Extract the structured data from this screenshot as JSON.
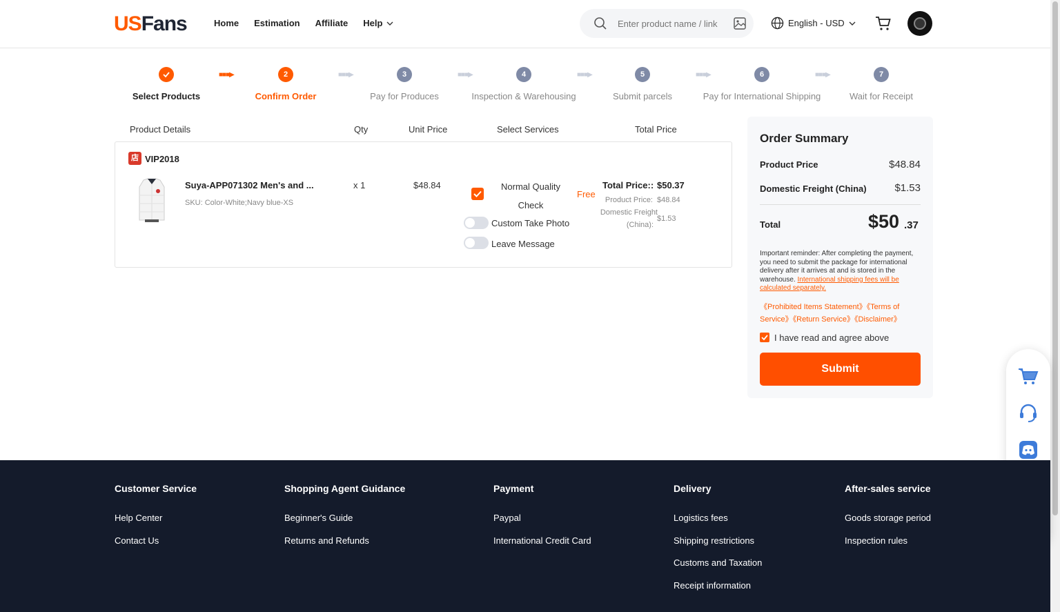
{
  "header": {
    "logo_us": "US",
    "logo_fans": "Fans",
    "nav": [
      "Home",
      "Estimation",
      "Affiliate",
      "Help"
    ],
    "search_placeholder": "Enter product name / link",
    "language": "English - USD"
  },
  "steps": [
    {
      "num": "",
      "label": "Select Products",
      "state": "done"
    },
    {
      "num": "2",
      "label": "Confirm Order",
      "state": "active"
    },
    {
      "num": "3",
      "label": "Pay for Produces",
      "state": "todo"
    },
    {
      "num": "4",
      "label": "Inspection & Warehousing",
      "state": "todo"
    },
    {
      "num": "5",
      "label": "Submit parcels",
      "state": "todo"
    },
    {
      "num": "6",
      "label": "Pay for International Shipping",
      "state": "todo"
    },
    {
      "num": "7",
      "label": "Wait for Receipt",
      "state": "todo"
    }
  ],
  "columns": {
    "details": "Product Details",
    "qty": "Qty",
    "unit_price": "Unit Price",
    "services": "Select Services",
    "total": "Total Price"
  },
  "order": {
    "store_badge": "店",
    "store": "VIP2018",
    "product_name": "Suya-APP071302 Men's and ...",
    "sku": "SKU: Color-White;Navy blue-XS",
    "qty": "x 1",
    "unit_price": "$48.84",
    "service_normal": "Normal Quality Check",
    "service_normal_price": "Free",
    "service_photo": "Custom Take Photo",
    "service_message": "Leave Message",
    "total_label": "Total Price::",
    "total_value": "$50.37",
    "product_price_label": "Product Price:",
    "product_price_value": "$48.84",
    "freight_label_1": "Domestic Freight",
    "freight_label_2": "(China):",
    "freight_value": "$1.53"
  },
  "summary": {
    "title": "Order Summary",
    "product_price_label": "Product Price",
    "product_price_value": "$48.84",
    "freight_label": "Domestic Freight (China)",
    "freight_value": "$1.53",
    "total_label": "Total",
    "total_int": "$50",
    "total_dec": ".37",
    "reminder": "Important reminder: After completing the payment, you need to submit the package for international delivery after it arrives at and is stored in the warehouse.",
    "reminder_link": "International shipping fees will be calculated separately.",
    "links": [
      "《Prohibited Items Statement》",
      "《Terms of Service》",
      "《Return Service》",
      "《Disclaimer》"
    ],
    "agree": "I have read and agree above",
    "submit": "Submit"
  },
  "footer": [
    {
      "title": "Customer Service",
      "links": [
        "Help Center",
        "Contact Us"
      ]
    },
    {
      "title": "Shopping Agent Guidance",
      "links": [
        "Beginner's Guide",
        "Returns and Refunds"
      ]
    },
    {
      "title": "Payment",
      "links": [
        "Paypal",
        "International Credit Card"
      ]
    },
    {
      "title": "Delivery",
      "links": [
        "Logistics fees",
        "Shipping restrictions",
        "Customs and Taxation",
        "Receipt information"
      ]
    },
    {
      "title": "After-sales service",
      "links": [
        "Goods storage period",
        "Inspection rules"
      ]
    }
  ],
  "colors": {
    "accent": "#ff5a00",
    "footer_bg": "#141b2b",
    "step_todo": "#7f8aa6"
  },
  "icons": [
    "search-icon",
    "image-search-icon",
    "globe-icon",
    "chevron-down-icon",
    "cart-icon",
    "check-icon",
    "customer-service-icon",
    "discord-icon",
    "telegram-icon",
    "whatsapp-icon"
  ]
}
